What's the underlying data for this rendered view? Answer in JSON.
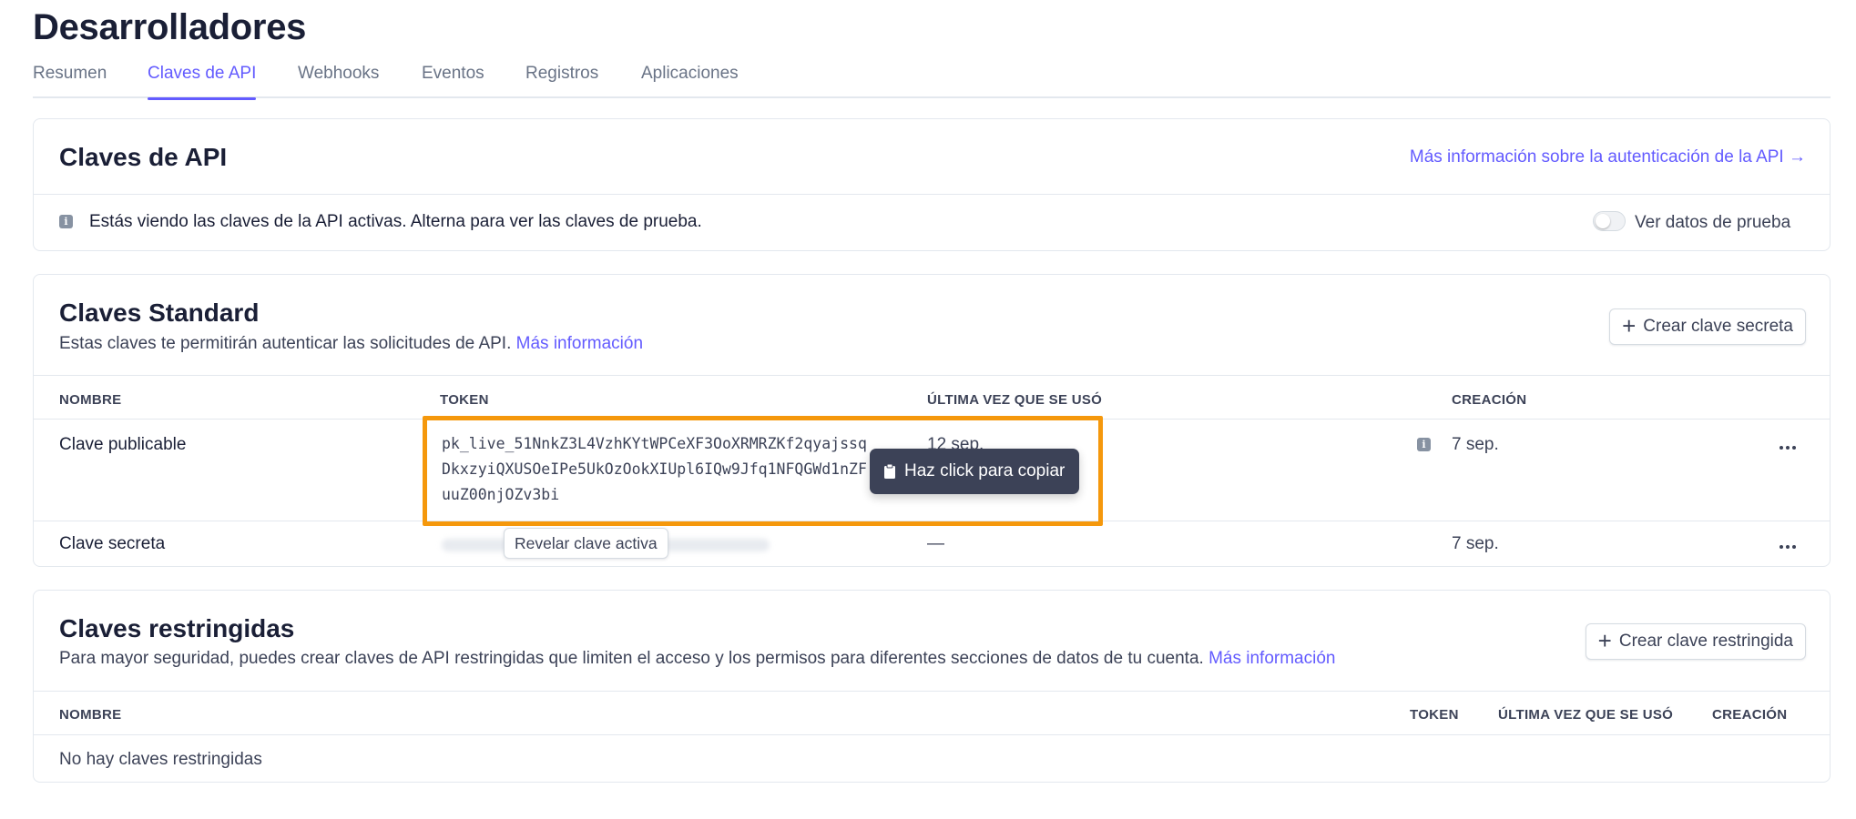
{
  "page": {
    "title": "Desarrolladores"
  },
  "tabs": [
    {
      "label": "Resumen"
    },
    {
      "label": "Claves de API"
    },
    {
      "label": "Webhooks"
    },
    {
      "label": "Eventos"
    },
    {
      "label": "Registros"
    },
    {
      "label": "Aplicaciones"
    }
  ],
  "active_tab": "Claves de API",
  "api_keys_card": {
    "title": "Claves de API",
    "docs_link": "Más información sobre la autenticación de la API →",
    "notice": "Estás viendo las claves de la API activas. Alterna para ver las claves de prueba.",
    "toggle_label": "Ver datos de prueba",
    "toggle_on": false
  },
  "standard_keys": {
    "title": "Claves Standard",
    "description": "Estas claves te permitirán autenticar las solicitudes de API.",
    "more_info": "Más información",
    "create_button": "Crear clave secreta",
    "columns": {
      "name": "NOMBRE",
      "token": "TOKEN",
      "last_used": "ÚLTIMA VEZ QUE SE USÓ",
      "created": "CREACIÓN"
    },
    "rows": [
      {
        "name": "Clave publicable",
        "token": "pk_live_51NnkZ3L4VzhKYtWPCeXF3OoXRMRZKf2qyajssqDkxzyiQXUSOeIPe5UkOzOokXIUpl6IQw9Jfq1NFQGWd1nZFuuZ00njOZv3bi",
        "last_used": "12 sep.",
        "created": "7 sep."
      },
      {
        "name": "Clave secreta",
        "reveal_button": "Revelar clave activa",
        "last_used": "—",
        "created": "7 sep."
      }
    ],
    "copy_tooltip": "Haz click para copiar"
  },
  "restricted_keys": {
    "title": "Claves restringidas",
    "description": "Para mayor seguridad, puedes crear claves de API restringidas que limiten el acceso y los permisos para diferentes secciones de datos de tu cuenta.",
    "more_info": "Más información",
    "create_button": "Crear clave restringida",
    "columns": {
      "name": "NOMBRE",
      "token": "TOKEN",
      "last_used": "ÚLTIMA VEZ QUE SE USÓ",
      "created": "CREACIÓN"
    },
    "empty": "No hay claves restringidas"
  },
  "colors": {
    "accent": "#635bff",
    "highlight": "#f5980c",
    "tooltip_bg": "#3c4257",
    "border": "#e3e8ee"
  }
}
